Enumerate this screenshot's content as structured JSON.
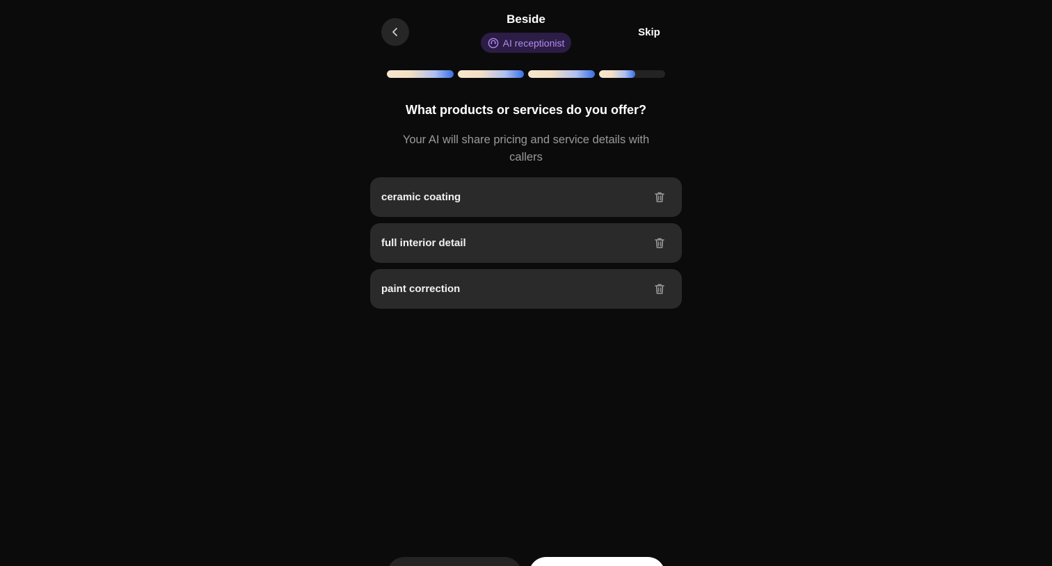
{
  "header": {
    "app_name": "Beside",
    "badge_label": "AI receptionist",
    "skip_label": "Skip"
  },
  "progress": {
    "segments": [
      1.0,
      1.0,
      1.0,
      0.55
    ]
  },
  "question": {
    "title": "What products or services do you offer?",
    "subtitle": "Your AI will share pricing and service details with callers"
  },
  "items": [
    {
      "label": "ceramic coating"
    },
    {
      "label": "full interior detail"
    },
    {
      "label": "paint correction"
    }
  ],
  "icons": {
    "back": "chevron-left-icon",
    "badge": "ai-receptionist-icon",
    "delete": "trash-icon"
  },
  "colors": {
    "background": "#0b0b0b",
    "card": "#2a2a2a",
    "badge_bg": "#2b1d45",
    "badge_text": "#b58bf0",
    "accent_blue": "#3a6fe6"
  }
}
